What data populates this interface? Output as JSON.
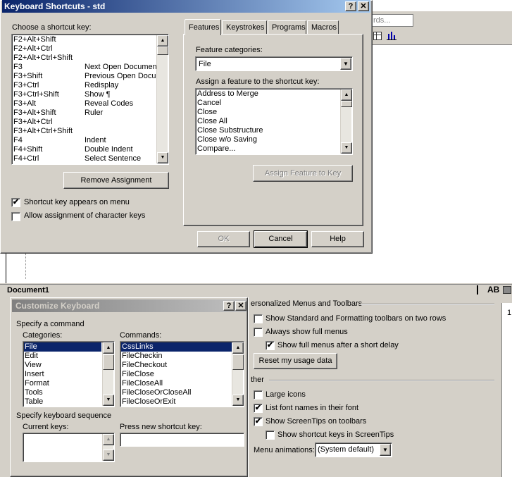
{
  "background_toolbar": {
    "hint_text": "rds...",
    "doc_title": "Document1",
    "right_icons": "AB",
    "partial_right_text": "1"
  },
  "shortcuts_dialog": {
    "title": "Keyboard Shortcuts - std",
    "help_glyph": "?",
    "close_glyph": "✕",
    "choose_label": "Choose a shortcut key:",
    "shortcuts": [
      {
        "key": "F2+Alt+Shift",
        "feature": ""
      },
      {
        "key": "F2+Alt+Ctrl",
        "feature": ""
      },
      {
        "key": "F2+Alt+Ctrl+Shift",
        "feature": ""
      },
      {
        "key": "F3",
        "feature": "Next Open Document"
      },
      {
        "key": "F3+Shift",
        "feature": "Previous Open Docu"
      },
      {
        "key": "F3+Ctrl",
        "feature": "Redisplay"
      },
      {
        "key": "F3+Ctrl+Shift",
        "feature": "Show ¶"
      },
      {
        "key": "F3+Alt",
        "feature": "Reveal Codes"
      },
      {
        "key": "F3+Alt+Shift",
        "feature": "Ruler"
      },
      {
        "key": "F3+Alt+Ctrl",
        "feature": ""
      },
      {
        "key": "F3+Alt+Ctrl+Shift",
        "feature": ""
      },
      {
        "key": "F4",
        "feature": "Indent"
      },
      {
        "key": "F4+Shift",
        "feature": "Double Indent"
      },
      {
        "key": "F4+Ctrl",
        "feature": "Select Sentence"
      }
    ],
    "remove_button": "Remove Assignment",
    "chk_appears_menu": "Shortcut key appears on menu",
    "chk_allow_chars": "Allow assignment of character keys",
    "tabs": [
      "Features",
      "Keystrokes",
      "Programs",
      "Macros"
    ],
    "feature_categories_label": "Feature categories:",
    "category_value": "File",
    "assign_label": "Assign a feature to the shortcut key:",
    "features": [
      "Address to Merge",
      "Cancel",
      "Close",
      "Close All",
      "Close Substructure",
      "Close w/o Saving",
      "Compare..."
    ],
    "assign_button": "Assign Feature to Key",
    "ok_button": "OK",
    "cancel_button": "Cancel",
    "help_button": "Help"
  },
  "customize_dialog": {
    "title": "Customize Keyboard",
    "help_glyph": "?",
    "close_glyph": "✕",
    "specify_command": "Specify a command",
    "categories_label": "Categories:",
    "categories": [
      "File",
      "Edit",
      "View",
      "Insert",
      "Format",
      "Tools",
      "Table"
    ],
    "commands_label": "Commands:",
    "commands": [
      "CssLinks",
      "FileCheckin",
      "FileCheckout",
      "FileClose",
      "FileCloseAll",
      "FileCloseOrCloseAll",
      "FileCloseOrExit"
    ],
    "specify_sequence": "Specify keyboard sequence",
    "current_keys_label": "Current keys:",
    "press_new_label": "Press new shortcut key:"
  },
  "options_panel": {
    "personalized_header": "ersonalized Menus and Toolbars",
    "chk_two_rows": "Show Standard and Formatting toolbars on two rows",
    "chk_full_menus": "Always show full menus",
    "chk_full_delay": "Show full menus after a short delay",
    "reset_button": "Reset my usage data",
    "other_header": "ther",
    "chk_large_icons": "Large icons",
    "chk_font_names": "List font names in their font",
    "chk_screentips": "Show ScreenTips on toolbars",
    "chk_shortcut_tips": "Show shortcut keys in ScreenTips",
    "menu_anim_label": "Menu animations:",
    "menu_anim_value": "(System default)"
  },
  "glyphs": {
    "check": "✔",
    "up": "▲",
    "down": "▼",
    "chevron_down": "▼"
  },
  "colors": {
    "title_active": "#0a246a",
    "title_active_end": "#a6caf0",
    "title_inactive": "#808080",
    "title_inactive_end": "#c0c0c0",
    "selection": "#0a246a"
  }
}
